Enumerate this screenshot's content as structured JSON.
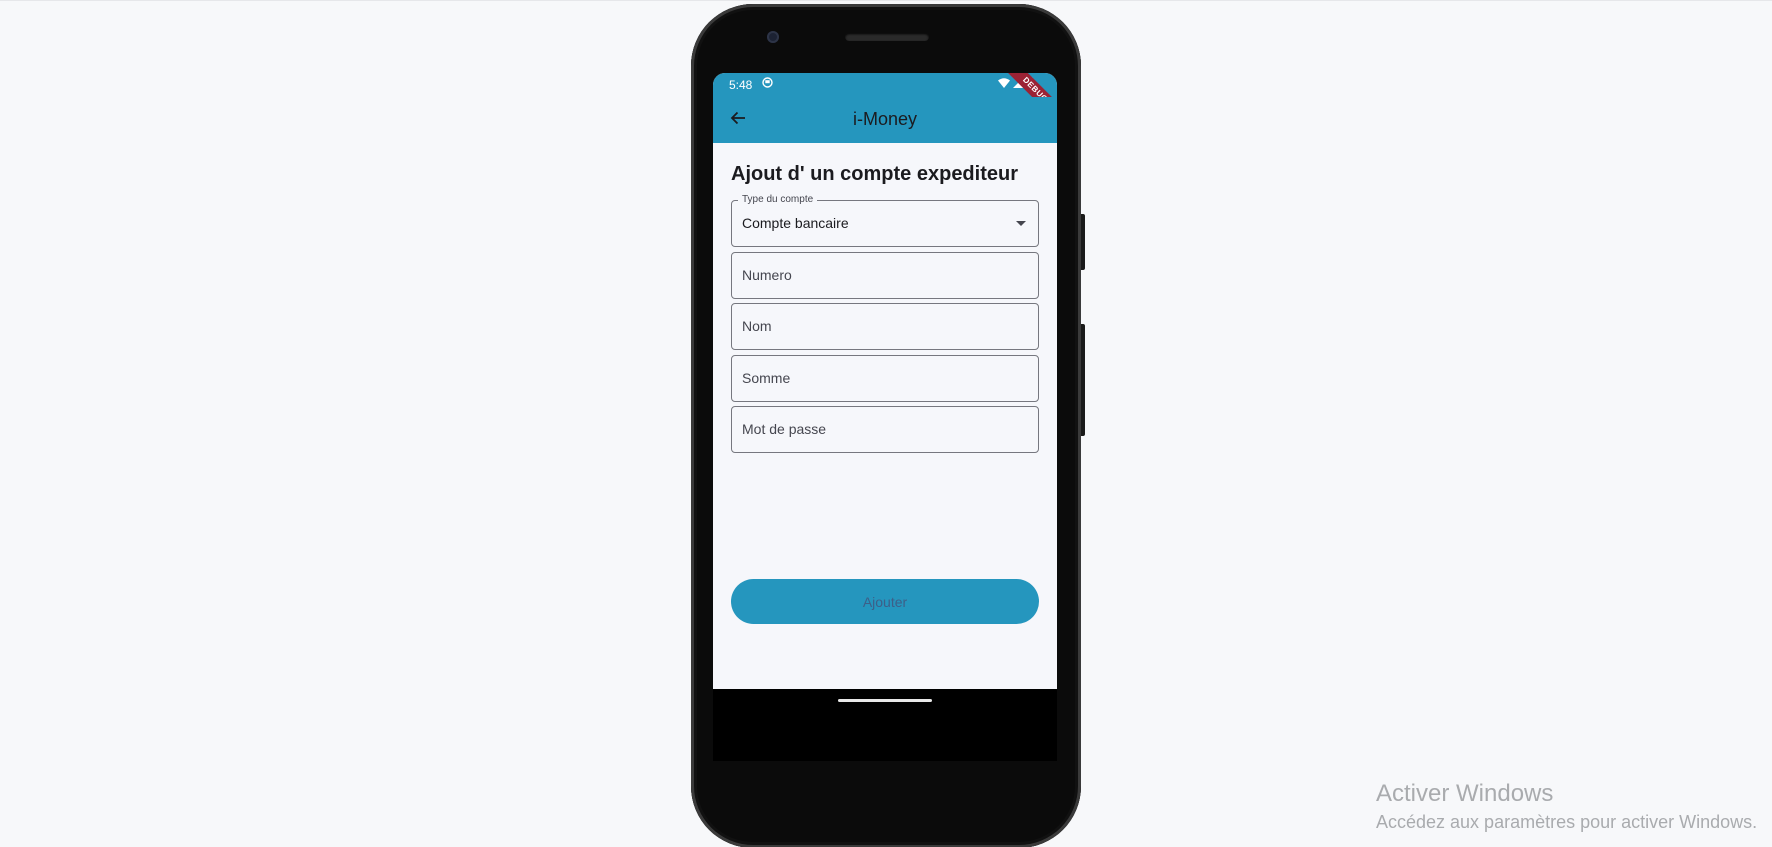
{
  "status_bar": {
    "time": "5:48",
    "debug_banner": "DEBUG"
  },
  "app_bar": {
    "title": "i-Money"
  },
  "form": {
    "heading": "Ajout d' un compte expediteur",
    "account_type": {
      "label": "Type du compte",
      "value": "Compte bancaire"
    },
    "fields": {
      "numero": "Numero",
      "nom": "Nom",
      "somme": "Somme",
      "mot_de_passe": "Mot de passe"
    },
    "submit_label": "Ajouter"
  },
  "colors": {
    "primary": "#2596be",
    "background": "#f6f7fb"
  },
  "icons": {
    "back": "arrow-left-icon",
    "dropdown": "caret-down-icon",
    "wifi": "wifi-icon",
    "signal": "signal-icon",
    "battery": "battery-icon",
    "notification": "notification-icon"
  },
  "windows_watermark": {
    "title": "Activer Windows",
    "subtitle": "Accédez aux paramètres pour activer Windows."
  }
}
